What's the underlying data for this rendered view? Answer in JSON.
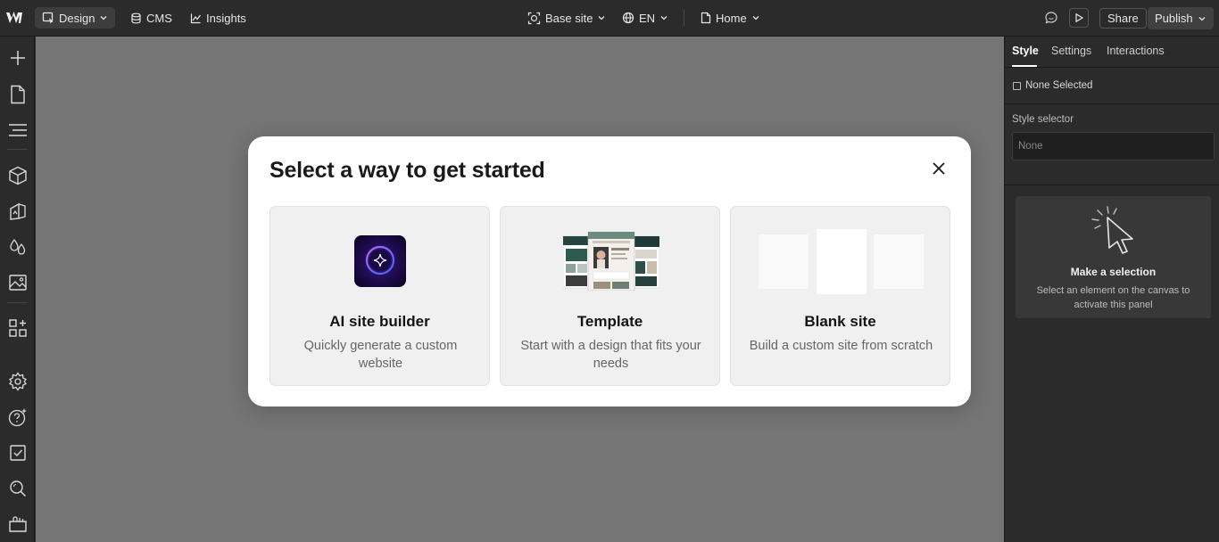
{
  "topbar": {
    "design_label": "Design",
    "cms_label": "CMS",
    "insights_label": "Insights",
    "base_site_label": "Base site",
    "locale_label": "EN",
    "page_label": "Home",
    "share_label": "Share",
    "publish_label": "Publish"
  },
  "left_sidebar": {
    "icons": [
      "add-icon",
      "pages-icon",
      "navigator-icon",
      "components-icon",
      "assets-icon",
      "variables-icon",
      "images-icon",
      "apps-icon",
      "settings-icon",
      "help-icon",
      "tasks-icon",
      "search-icon",
      "marketplace-icon"
    ]
  },
  "right_panel": {
    "tabs": [
      {
        "label": "Style"
      },
      {
        "label": "Settings"
      },
      {
        "label": "Interactions"
      }
    ],
    "none_selected_label": "None Selected",
    "style_selector_label": "Style selector",
    "style_selector_placeholder": "None",
    "empty_state": {
      "title": "Make a selection",
      "description": "Select an element on the canvas to activate this panel"
    }
  },
  "modal": {
    "title": "Select a way to get started",
    "options": [
      {
        "title": "AI site builder",
        "description": "Quickly generate a custom website"
      },
      {
        "title": "Template",
        "description": "Start with a design that fits your needs"
      },
      {
        "title": "Blank site",
        "description": "Build a custom site from scratch"
      }
    ]
  },
  "colors": {
    "chrome_bg": "#2b2b2b",
    "canvas_bg": "#757575",
    "modal_bg": "#ffffff",
    "option_bg": "#f0f0f0",
    "ai_tile": "#2a1060",
    "ai_glow": "#8a5cff"
  }
}
